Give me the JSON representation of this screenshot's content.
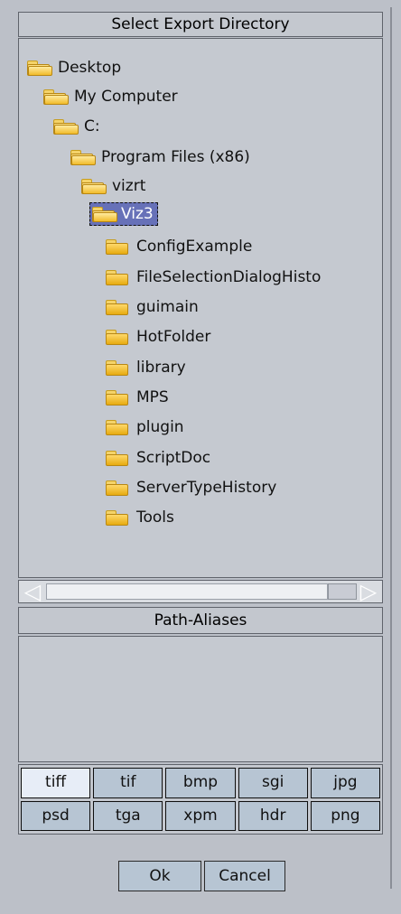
{
  "dialog": {
    "title": "Select Export Directory",
    "tree": {
      "items": [
        {
          "label": "Desktop"
        },
        {
          "label": "My Computer"
        },
        {
          "label": "C:"
        },
        {
          "label": "Program Files (x86)"
        },
        {
          "label": "vizrt"
        },
        {
          "label": "Viz3",
          "selected": true
        },
        {
          "label": "ConfigExample"
        },
        {
          "label": "FileSelectionDialogHisto"
        },
        {
          "label": "guimain"
        },
        {
          "label": "HotFolder"
        },
        {
          "label": "library"
        },
        {
          "label": "MPS"
        },
        {
          "label": "plugin"
        },
        {
          "label": "ScriptDoc"
        },
        {
          "label": "ServerTypeHistory"
        },
        {
          "label": "Tools"
        }
      ]
    },
    "path_aliases": {
      "label": "Path-Aliases"
    },
    "formats": [
      {
        "label": "tiff",
        "selected": true
      },
      {
        "label": "tif"
      },
      {
        "label": "bmp"
      },
      {
        "label": "sgi"
      },
      {
        "label": "jpg"
      },
      {
        "label": "psd"
      },
      {
        "label": "tga"
      },
      {
        "label": "xpm"
      },
      {
        "label": "hdr"
      },
      {
        "label": "png"
      }
    ],
    "buttons": {
      "ok": "Ok",
      "cancel": "Cancel"
    },
    "colors": {
      "background": "#bcc0c8",
      "selection": "#6771b8",
      "button_fill": "#b7c5d3",
      "active_format": "#e7edf7"
    }
  }
}
